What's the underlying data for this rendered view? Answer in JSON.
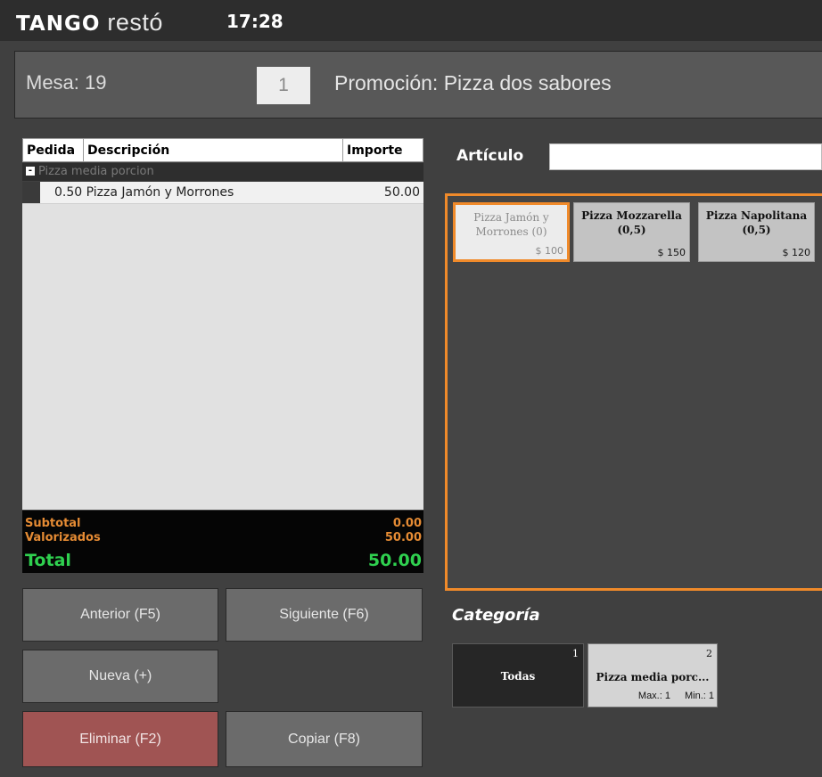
{
  "app": {
    "brand": "TANGO",
    "product": "restó",
    "time": "17:28"
  },
  "header": {
    "mesa": "Mesa: 19",
    "quantity": "1",
    "promotion": "Promoción: Pizza dos sabores"
  },
  "order_table": {
    "columns": [
      "Pedida",
      "Descripción",
      "Importe"
    ],
    "group": "Pizza media porcion",
    "group_toggle": "-",
    "rows": [
      {
        "description": "0.50 Pizza Jamón y Morrones",
        "amount": "50.00"
      }
    ]
  },
  "totals": {
    "subtotal_label": "Subtotal",
    "subtotal": "0.00",
    "valorizados_label": "Valorizados",
    "valorizados": "50.00",
    "total_label": "Total",
    "total": "50.00"
  },
  "buttons": {
    "anterior": "Anterior (F5)",
    "siguiente": "Siguiente (F6)",
    "nueva": "Nueva (+)",
    "eliminar": "Eliminar (F2)",
    "copiar": "Copiar (F8)"
  },
  "articulo": {
    "label": "Artículo",
    "value": ""
  },
  "articles": [
    {
      "name_line1": "Pizza Jamón y",
      "name_line2": "Morrones (0)",
      "price": "$ 100"
    },
    {
      "name_line1": "Pizza Mozzarella",
      "name_line2": "(0,5)",
      "price": "$ 150"
    },
    {
      "name_line1": "Pizza Napolitana",
      "name_line2": "(0,5)",
      "price": "$ 120"
    }
  ],
  "categoria": {
    "label": "Categoría",
    "items": [
      {
        "number": "1",
        "name": "Todas"
      },
      {
        "number": "2",
        "name": "Pizza media porc...",
        "max": "Max.: 1",
        "min": "Min.: 1"
      }
    ]
  },
  "colors": {
    "accent": "#f08a2a",
    "total_green": "#2fd04f",
    "delete_red": "#a05453"
  }
}
